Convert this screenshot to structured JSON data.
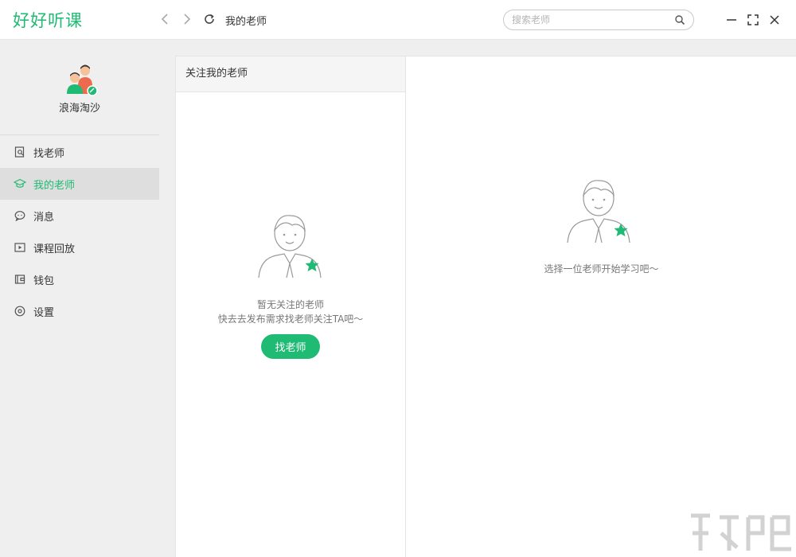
{
  "app": {
    "logo": "好好听课"
  },
  "header": {
    "page_title": "我的老师",
    "search_placeholder": "搜索老师"
  },
  "profile": {
    "username": "浪海淘沙"
  },
  "sidebar": {
    "items": [
      {
        "label": "找老师",
        "icon": "find-teacher-icon",
        "active": false
      },
      {
        "label": "我的老师",
        "icon": "graduation-cap-icon",
        "active": true
      },
      {
        "label": "消息",
        "icon": "message-icon",
        "active": false
      },
      {
        "label": "课程回放",
        "icon": "playback-icon",
        "active": false
      },
      {
        "label": "钱包",
        "icon": "wallet-icon",
        "active": false
      },
      {
        "label": "设置",
        "icon": "settings-icon",
        "active": false
      }
    ]
  },
  "main": {
    "column_title": "关注我的老师",
    "empty_line1": "暂无关注的老师",
    "empty_line2": "快去去发布需求找老师关注TA吧～",
    "find_button": "找老师",
    "right_hint": "选择一位老师开始学习吧～"
  },
  "colors": {
    "accent": "#1fba73",
    "sidebar_bg": "#efefef"
  }
}
